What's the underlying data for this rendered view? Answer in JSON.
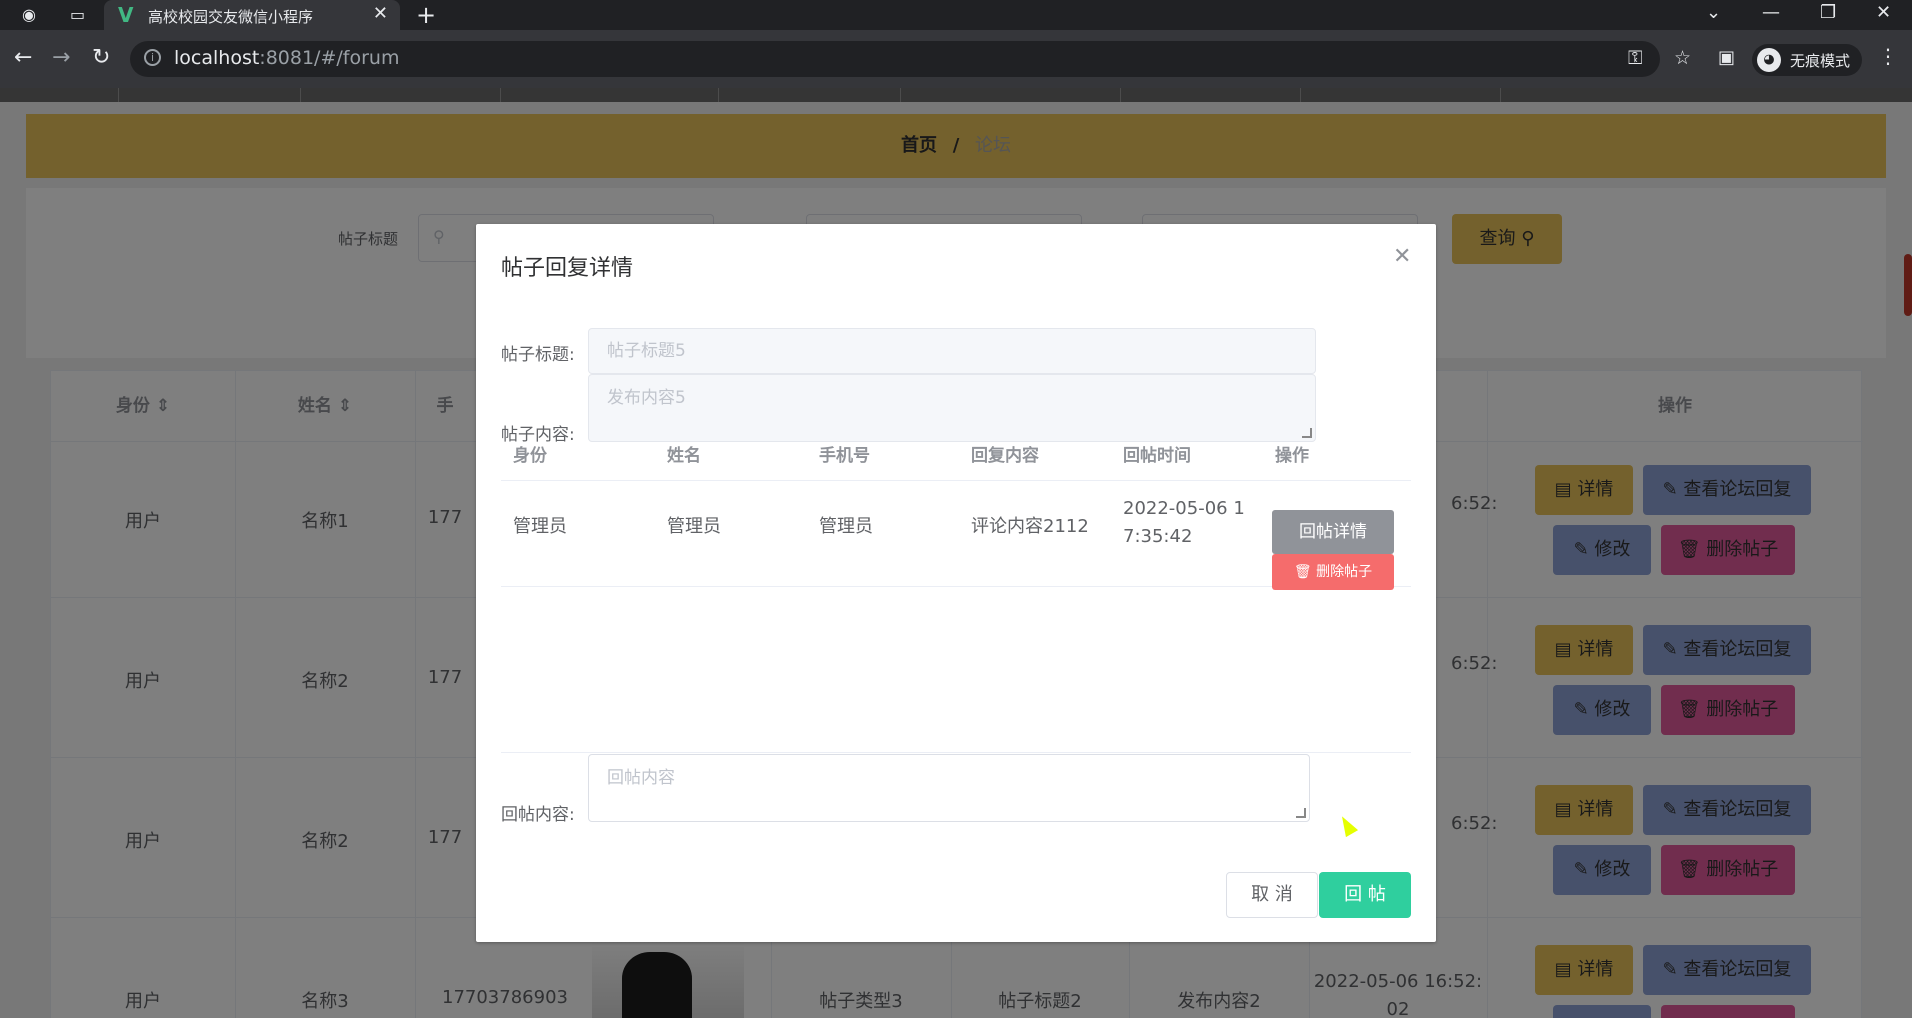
{
  "browser": {
    "tab_title": "高校校园交友微信小程序",
    "url_host": "localhost",
    "url_rest": ":8081/#/forum",
    "incognito_label": "无痕模式"
  },
  "breadcrumb": {
    "home": "首页",
    "separator": "/",
    "current": "论坛"
  },
  "search": {
    "title_label": "帖子标题",
    "query_button": "查询"
  },
  "table": {
    "headers": [
      "身份",
      "姓名",
      "手",
      "操作"
    ],
    "rows": [
      {
        "role": "用户",
        "name": "名称1",
        "phone": "177",
        "time": "6:52:"
      },
      {
        "role": "用户",
        "name": "名称2",
        "phone": "177",
        "time": "6:52:"
      },
      {
        "role": "用户",
        "name": "名称2",
        "phone": "177",
        "time": "6:52:"
      },
      {
        "role": "用户",
        "name": "名称3",
        "phone": "17703786903",
        "type": "帖子类型3",
        "title": "帖子标题2",
        "content": "发布内容2",
        "time": "2022-05-06 16:52:",
        "time2": "02"
      }
    ],
    "actions": {
      "detail": "详情",
      "view_replies": "查看论坛回复",
      "edit": "修改",
      "delete": "删除帖子"
    }
  },
  "dialog": {
    "title": "帖子回复详情",
    "post_title_label": "帖子标题:",
    "post_title_value": "帖子标题5",
    "post_content_label": "帖子内容:",
    "post_content_value": "发布内容5",
    "replies": {
      "headers": [
        "身份",
        "姓名",
        "手机号",
        "回复内容",
        "回帖时间",
        "操作"
      ],
      "rows": [
        {
          "role": "管理员",
          "name": "管理员",
          "phone": "管理员",
          "content": "评论内容2112",
          "time_a": "2022-05-06 1",
          "time_b": "7:35:42",
          "detail_btn": "回帖详情",
          "delete_btn": "删除帖子"
        }
      ]
    },
    "reply_label": "回帖内容:",
    "reply_placeholder": "回帖内容",
    "cancel": "取 消",
    "submit": "回 帖"
  }
}
